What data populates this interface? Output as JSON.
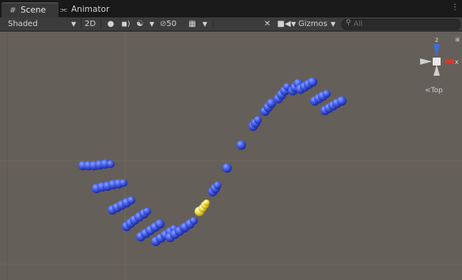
{
  "tabs": [
    {
      "label": "Scene",
      "icon": "grid-icon"
    },
    {
      "label": "Animator",
      "icon": "animator-icon"
    }
  ],
  "toolbar": {
    "draw_mode": "Shaded",
    "mode_2d": "2D",
    "hidden_count": "50",
    "gizmos_label": "Gizmos",
    "search_placeholder": "All"
  },
  "gizmo": {
    "view_label": "Top",
    "axis_z": "z",
    "axis_x": "x"
  },
  "colors": {
    "background": "#655f59",
    "sphere": "#3a52e0",
    "selected_sphere": "#f0e24a",
    "axis_x": "#e0352b",
    "axis_z": "#3c6ee0"
  }
}
